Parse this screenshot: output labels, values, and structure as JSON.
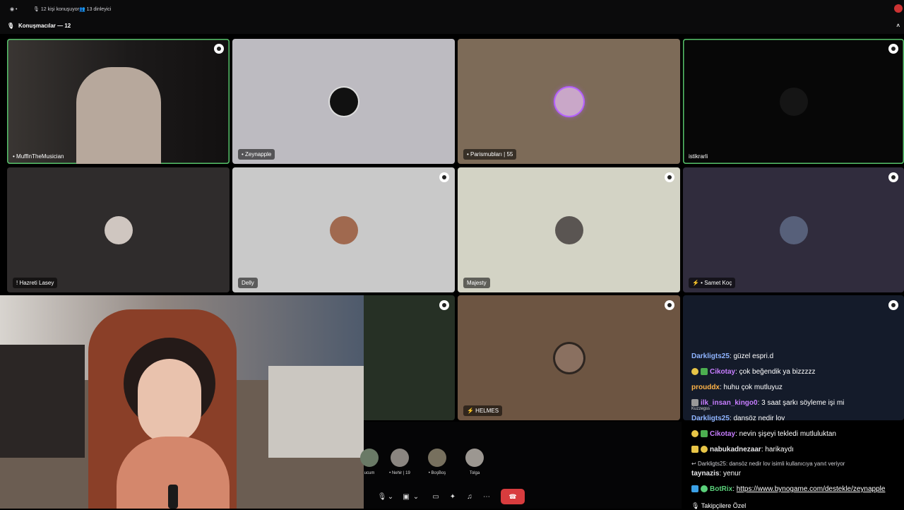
{
  "topbar": {
    "listeners_speaking": "12 kişi konuşuyor",
    "listeners": "13 dinleyici"
  },
  "speakers_header": "Konuşmacılar — 12",
  "tiles": [
    {
      "name": "• MuffInTheMusician"
    },
    {
      "name": "• Zeynapple"
    },
    {
      "name": "• Parismubları | 55"
    },
    {
      "name": "istikrarli"
    },
    {
      "name": "! Hazreti Lasey"
    },
    {
      "name": "Delly"
    },
    {
      "name": "Majesty"
    },
    {
      "name": "⚡ • Samet Koç"
    },
    {
      "name": "⚡ HELMES"
    }
  ],
  "dock": {
    "participants": [
      "ucum",
      "• Nehir | 19",
      "• BoşBoş",
      "Tolga"
    ]
  },
  "chat": {
    "messages": [
      {
        "user": "Darkligts25",
        "text": ": güzel espri.d",
        "color": "#8fb4ff"
      },
      {
        "user": "Cikotay",
        "text": ": çok beğendik ya bizzzzz",
        "color": "#c77dff"
      },
      {
        "user": "prouddx",
        "text": ": huhu çok mutluyuz",
        "color": "#ffb347"
      },
      {
        "user": "ilk_insan_kingo0",
        "text": ": 3 saat şarkı söyleme işi mi",
        "color": "#c77dff"
      },
      {
        "user": "Darkligts25",
        "text": ": dansöz nedir lov",
        "color": "#8fb4ff"
      },
      {
        "user": "Cikotay",
        "text": ": nevin şişeyi tekledi mutluluktan",
        "color": "#c77dff"
      },
      {
        "user": "nabukadnezaar",
        "text": ": harikaydı",
        "color": "#e7e7ea"
      },
      {
        "user": "taynazis",
        "text": ": yenur",
        "color": "#e7e7ea"
      },
      {
        "user": "BotRix",
        "text": "https://www.bynogame.com/destekle/zeynapple",
        "color": "#5ad07a"
      }
    ],
    "kuzzegss": "Kuzzegss",
    "reply_note": "Darkligts25: dansöz nedir lov isimli kullanıcıya yanıt veriyor",
    "footer": "Takipçilere Özel"
  }
}
